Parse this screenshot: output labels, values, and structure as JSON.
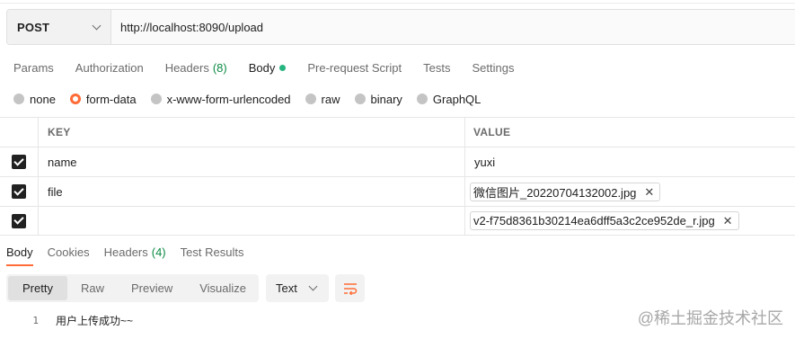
{
  "request": {
    "method": "POST",
    "url": "http://localhost:8090/upload"
  },
  "request_tabs": [
    {
      "label": "Params"
    },
    {
      "label": "Authorization"
    },
    {
      "label": "Headers",
      "count": "(8)"
    },
    {
      "label": "Body"
    },
    {
      "label": "Pre-request Script"
    },
    {
      "label": "Tests"
    },
    {
      "label": "Settings"
    }
  ],
  "body_types": [
    {
      "label": "none"
    },
    {
      "label": "form-data"
    },
    {
      "label": "x-www-form-urlencoded"
    },
    {
      "label": "raw"
    },
    {
      "label": "binary"
    },
    {
      "label": "GraphQL"
    }
  ],
  "selected_body_type": "form-data",
  "params_table": {
    "headers": {
      "key": "KEY",
      "value": "VALUE"
    },
    "rows": [
      {
        "checked": true,
        "key": "name",
        "value": "yuxi"
      },
      {
        "checked": true,
        "key": "file",
        "file": "微信图片_20220704132002.jpg"
      },
      {
        "checked": true,
        "key": "",
        "file": "v2-f75d8361b30214ea6dff5a3c2ce952de_r.jpg"
      }
    ]
  },
  "response_tabs": [
    {
      "label": "Body"
    },
    {
      "label": "Cookies"
    },
    {
      "label": "Headers",
      "count": "(4)"
    },
    {
      "label": "Test Results"
    }
  ],
  "view_modes": [
    "Pretty",
    "Raw",
    "Preview",
    "Visualize"
  ],
  "format": "Text",
  "response_body": {
    "line_number": "1",
    "text": "用户上传成功~~"
  },
  "watermark": "@稀土掘金技术社区",
  "colors": {
    "accent": "#ff6c37",
    "green_dot": "#26b47f",
    "count_green": "#0c8a45"
  }
}
